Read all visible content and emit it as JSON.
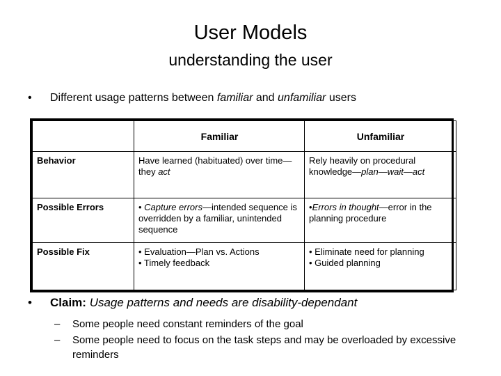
{
  "slide": {
    "title": "User Models",
    "subtitle": "understanding the user"
  },
  "top_bullet": {
    "marker": "•",
    "part1": "Different usage patterns between ",
    "italic1": "familiar",
    "part2": " and ",
    "italic2": "unfamiliar",
    "part3": " users"
  },
  "table": {
    "headers": {
      "corner": "",
      "familiar": "Familiar",
      "unfamiliar": "Unfamiliar"
    },
    "rows": [
      {
        "label": "Behavior",
        "familiar": {
          "line_plain_1": "Have learned (habituated) over time—they ",
          "line_italic_1": "act"
        },
        "unfamiliar": {
          "plain_1": "Rely heavily on procedural knowledge—",
          "italic_1": "plan",
          "plain_2": "—",
          "italic_2": "wait",
          "plain_3": "—",
          "italic_3": "act"
        }
      },
      {
        "label": "Possible Errors",
        "familiar": {
          "bullet_marker": "• ",
          "italic_1": "Capture errors",
          "plain_1": "—intended sequence is overridden by a familiar, unintended sequence"
        },
        "unfamiliar": {
          "bullet_marker": "•",
          "italic_1": "Errors in thought",
          "plain_1": "—error in the planning procedure"
        }
      },
      {
        "label": "Possible Fix",
        "familiar": {
          "bullets": [
            "• Evaluation—Plan vs. Actions",
            "• Timely feedback"
          ]
        },
        "unfamiliar": {
          "bullets": [
            "• Eliminate need for planning",
            "• Guided planning"
          ]
        }
      }
    ]
  },
  "claim": {
    "marker": "•",
    "label": "Claim:",
    "text": " Usage patterns and needs are disability-dependant"
  },
  "sub_bullets": {
    "dash": "–",
    "items": [
      "Some people need constant reminders of the goal",
      "Some people need to focus on the task steps and may be overloaded by excessive reminders"
    ]
  },
  "colors": {
    "text": "#000000",
    "background": "#ffffff",
    "table_border": "#000000"
  }
}
